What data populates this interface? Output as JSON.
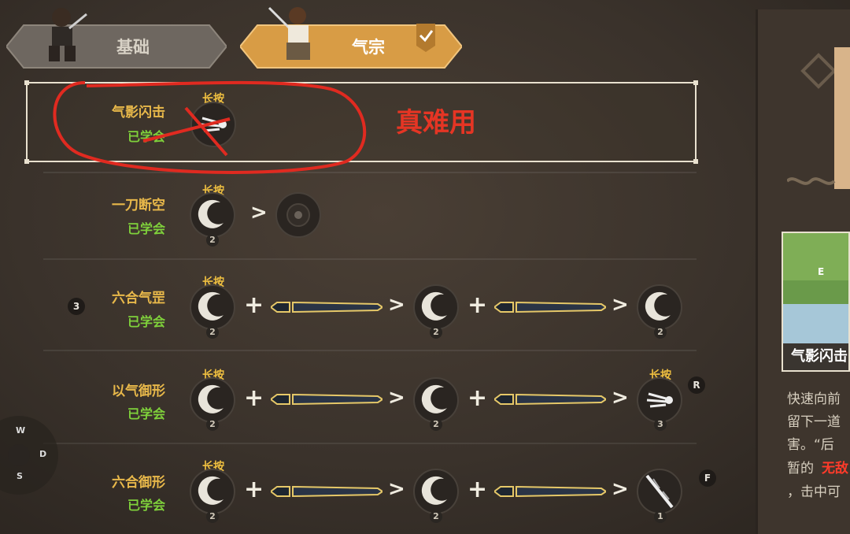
{
  "tabs": [
    {
      "label": "基础",
      "selected": false
    },
    {
      "label": "气宗",
      "selected": true
    }
  ],
  "annotation": "真难用",
  "hold_label": "长按",
  "skills": [
    {
      "name": "气影闪击",
      "status": "已学会",
      "hold": "长按"
    },
    {
      "name": "一刀断空",
      "status": "已学会",
      "hold": "长按",
      "counts": [
        "2"
      ]
    },
    {
      "name": "六合气罡",
      "status": "已学会",
      "hold": "长按",
      "counts": [
        "2",
        "2",
        "2"
      ],
      "badge": "3"
    },
    {
      "name": "以气御形",
      "status": "已学会",
      "hold": "长按",
      "hold2": "长按",
      "counts": [
        "2",
        "2",
        "3"
      ],
      "key": "R"
    },
    {
      "name": "六合御形",
      "status": "已学会",
      "hold": "长按",
      "counts": [
        "2",
        "2",
        "1"
      ],
      "key": "F"
    }
  ],
  "ops": {
    "plus": "+",
    "arrow": ">"
  },
  "preview": {
    "title": "气影闪击",
    "key": "E"
  },
  "description": [
    "快速向前",
    "留下一道",
    "害。“后",
    "暂的",
    "无敌",
    "，击中可"
  ],
  "joystick": {
    "up": "W",
    "down": "S",
    "right": "D"
  },
  "colors": {
    "accent": "#e8b84a",
    "learned": "#7fd13b",
    "annotation": "#e53524"
  }
}
